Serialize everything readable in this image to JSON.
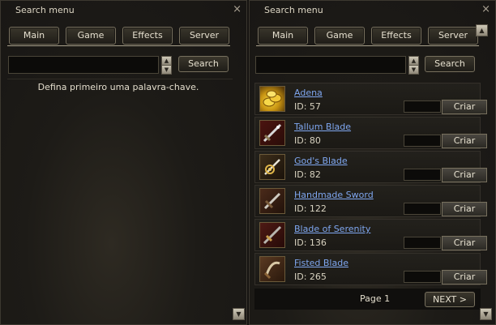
{
  "left_panel": {
    "title": "Search menu",
    "close_glyph": "×",
    "tabs": [
      "Main",
      "Game",
      "Effects",
      "Server"
    ],
    "search_value": "",
    "search_button": "Search",
    "hint": "Defina primeiro uma palavra-chave."
  },
  "right_panel": {
    "title": "Search menu",
    "close_glyph": "×",
    "tabs": [
      "Main",
      "Game",
      "Effects",
      "Server"
    ],
    "search_value": "",
    "search_button": "Search",
    "results": [
      {
        "name": "Adena",
        "id": "ID: 57",
        "icon": "adena-coins-icon",
        "action": "Criar"
      },
      {
        "name": "Tallum Blade",
        "id": "ID: 80",
        "icon": "tallum-blade-icon",
        "action": "Criar"
      },
      {
        "name": "God's Blade",
        "id": "ID: 82",
        "icon": "gods-blade-icon",
        "action": "Criar"
      },
      {
        "name": "Handmade Sword",
        "id": "ID: 122",
        "icon": "handmade-sword-icon",
        "action": "Criar"
      },
      {
        "name": "Blade of Serenity",
        "id": "ID: 136",
        "icon": "blade-of-serenity-icon",
        "action": "Criar"
      },
      {
        "name": "Fisted Blade",
        "id": "ID: 265",
        "icon": "fisted-blade-icon",
        "action": "Criar"
      }
    ],
    "page_label": "Page 1",
    "next_button": "NEXT >"
  },
  "icons": {
    "scroll_up": "scroll-up-arrow-icon",
    "scroll_down": "scroll-down-arrow-icon",
    "spinner": "spinner-icon"
  },
  "colors": {
    "link": "#7fa7f0",
    "panel_bg": "#1d1b17",
    "button_border": "#77705e"
  }
}
